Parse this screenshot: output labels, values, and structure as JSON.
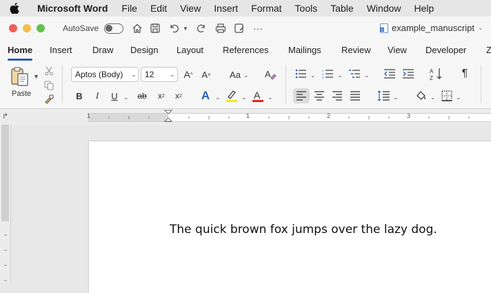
{
  "menubar": {
    "app_name": "Microsoft Word",
    "items": [
      "File",
      "Edit",
      "View",
      "Insert",
      "Format",
      "Tools",
      "Table",
      "Window",
      "Help"
    ]
  },
  "titlebar": {
    "autosave_label": "AutoSave",
    "document_title": "example_manuscript"
  },
  "tabs": [
    "Home",
    "Insert",
    "Draw",
    "Design",
    "Layout",
    "References",
    "Mailings",
    "Review",
    "View",
    "Developer",
    "Zo"
  ],
  "ribbon": {
    "paste_label": "Paste",
    "font_name": "Aptos (Body)",
    "font_size": "12"
  },
  "ruler": {
    "marks": [
      "1",
      "1",
      "2",
      "3"
    ]
  },
  "document": {
    "body_text": "The quick brown fox jumps over the lazy dog."
  },
  "colors": {
    "accent": "#2b5fb4",
    "highlight": "#f1e61d",
    "font_color": "#e0241b",
    "close": "#ee5f57",
    "minimize": "#f4bd4f",
    "maximize": "#5fc548"
  }
}
